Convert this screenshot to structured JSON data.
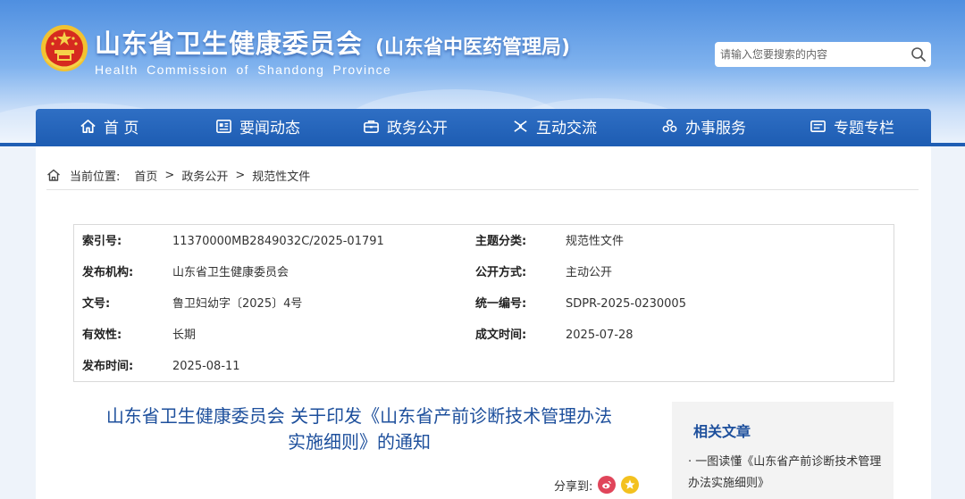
{
  "header": {
    "title": "山东省卫生健康委员会",
    "subtitle": "(山东省中医药管理局)",
    "english_name": "Health Commission of Shandong Province",
    "search_placeholder": "请输入您要搜索的内容",
    "search_icon": "search-icon",
    "emblem_icon": "national-emblem-icon"
  },
  "nav": {
    "items": [
      {
        "label": "首 页",
        "icon": "home-icon"
      },
      {
        "label": "要闻动态",
        "icon": "news-icon"
      },
      {
        "label": "政务公开",
        "icon": "briefcase-icon"
      },
      {
        "label": "互动交流",
        "icon": "interaction-icon"
      },
      {
        "label": "办事服务",
        "icon": "service-icon"
      },
      {
        "label": "专题专栏",
        "icon": "column-icon"
      }
    ]
  },
  "breadcrumb": {
    "prefix": "当前位置:",
    "items": [
      "首页",
      "政务公开",
      "规范性文件"
    ],
    "separator": ">"
  },
  "meta": {
    "index_no_label": "索引号:",
    "index_no": "11370000MB2849032C/2025-01791",
    "topic_label": "主题分类:",
    "topic": "规范性文件",
    "publisher_label": "发布机构:",
    "publisher": "山东省卫生健康委员会",
    "public_mode_label": "公开方式:",
    "public_mode": "主动公开",
    "doc_no_label": "文号:",
    "doc_no": "鲁卫妇幼字〔2025〕4号",
    "unified_no_label": "统一编号:",
    "unified_no": "SDPR-2025-0230005",
    "validity_label": "有效性:",
    "validity": "长期",
    "created_label": "成文时间:",
    "created": "2025-07-28",
    "published_label": "发布时间:",
    "published": "2025-08-11"
  },
  "article": {
    "title_line1": "山东省卫生健康委员会 关于印发《山东省产前诊断技术管理办法",
    "title_line2": "实施细则》的通知",
    "share_label": "分享到:"
  },
  "sidebar": {
    "title": "相关文章",
    "items": [
      {
        "label": "· 一图读懂《山东省产前诊断技术管理办法实施细则》"
      }
    ]
  },
  "colors": {
    "nav_blue": "#1f5eb4",
    "title_blue": "#1d4f9c",
    "weibo_red": "#e0455a",
    "qzone_yellow": "#f3c11f"
  }
}
